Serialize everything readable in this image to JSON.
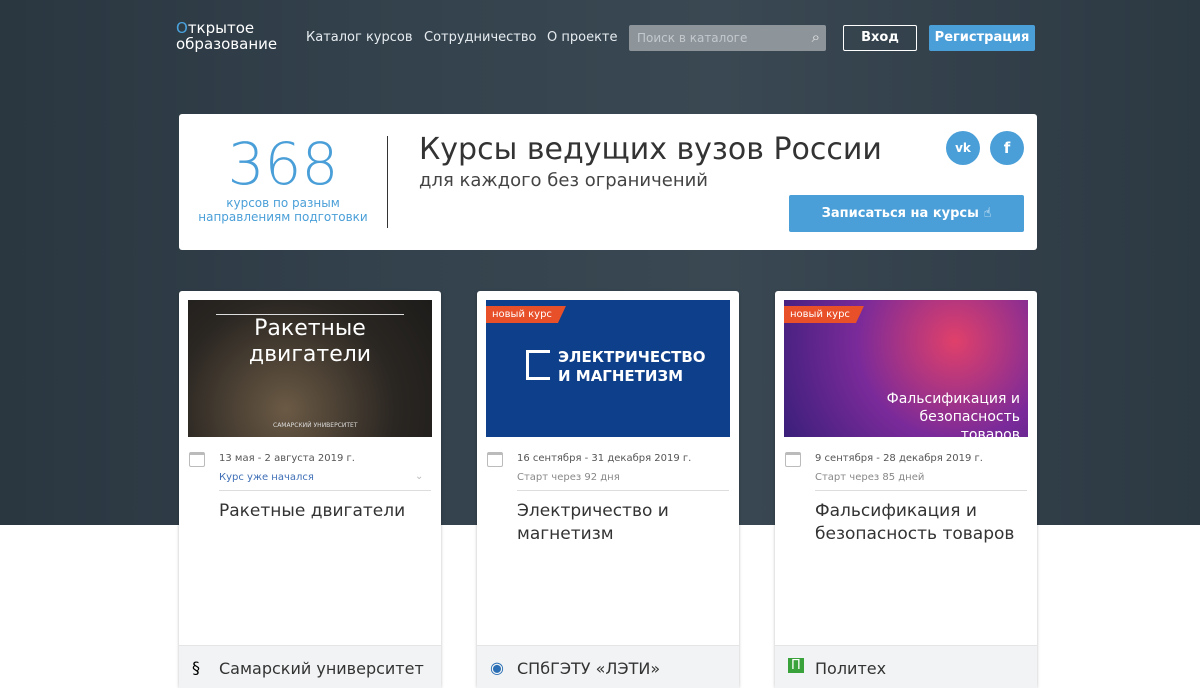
{
  "header": {
    "logo_line1_mark": "О",
    "logo_line1": "ткрытое",
    "logo_line2": "образование",
    "nav": [
      "Каталог курсов",
      "Сотрудничество",
      "О проекте"
    ],
    "search_placeholder": "Поиск в каталоге",
    "search_icon": "magnifier-icon",
    "login": "Вход",
    "register": "Регистрация"
  },
  "banner": {
    "count": "368",
    "count_label_1": "курсов по разным",
    "count_label_2": "направлениям подготовки",
    "title": "Курсы ведущих вузов России",
    "subtitle": "для каждого без ограничений",
    "social": [
      "vk",
      "f"
    ],
    "enroll": "Записаться на курсы",
    "enroll_icon": "hand-pointer-icon"
  },
  "colors": {
    "accent": "#4a9fd8",
    "tag": "#e8502a",
    "hero_bg": "#33414c"
  },
  "cards": [
    {
      "image_text_1": "Ракетные",
      "image_text_2": "двигатели",
      "image_caption": "САМАРСКИЙ УНИВЕРСИТЕТ",
      "tag": "",
      "date": "13 мая - 2 августа 2019 г.",
      "status": "Курс уже начался",
      "title": "Ракетные двигатели",
      "university": "Самарский университет",
      "uicon": "§"
    },
    {
      "image_text_1": "ЭЛЕКТРИЧЕСТВО",
      "image_text_2": "И МАГНЕТИЗМ",
      "tag": "новый курс",
      "date": "16 сентября - 31 декабря 2019 г.",
      "status": "Старт через 92 дня",
      "title": "Электричество и магнетизм",
      "university": "СПбГЭТУ «ЛЭТИ»",
      "uicon": "◉"
    },
    {
      "image_text_1": "Фальсификация и",
      "image_text_2": "безопасность",
      "image_text_3": "товаров",
      "tag": "новый курс",
      "date": "9 сентября - 28 декабря 2019 г.",
      "status": "Старт через 85 дней",
      "title": "Фальсификация и безопасность товаров",
      "university": "Политех",
      "uicon": "П"
    }
  ]
}
